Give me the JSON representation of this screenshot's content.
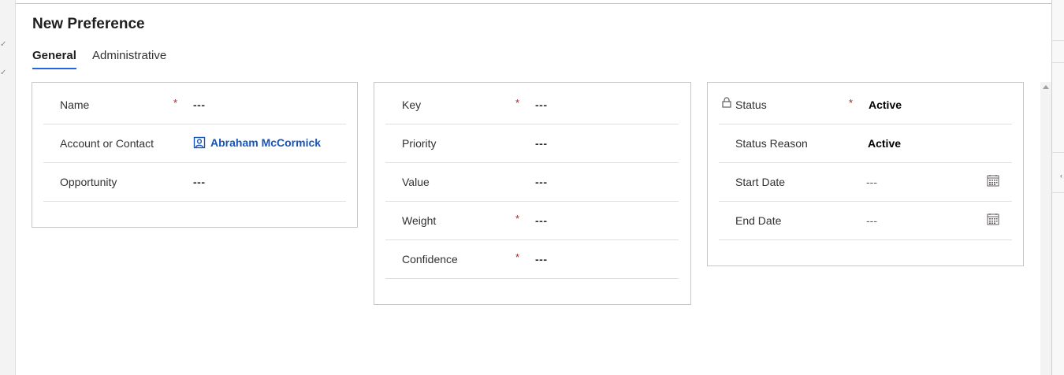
{
  "dialog": {
    "title": "New Preference"
  },
  "tabs": [
    {
      "label": "General",
      "active": true
    },
    {
      "label": "Administrative",
      "active": false
    }
  ],
  "section_left": {
    "rows": [
      {
        "label": "Name",
        "required": true,
        "value": "---"
      },
      {
        "label": "Account or Contact",
        "required": false,
        "value": "Abraham McCormick",
        "icon": "contact-icon"
      },
      {
        "label": "Opportunity",
        "required": false,
        "value": "---"
      }
    ]
  },
  "section_middle": {
    "rows": [
      {
        "label": "Key",
        "required": true,
        "value": "---"
      },
      {
        "label": "Priority",
        "required": false,
        "value": "---"
      },
      {
        "label": "Value",
        "required": false,
        "value": "---"
      },
      {
        "label": "Weight",
        "required": true,
        "value": "---"
      },
      {
        "label": "Confidence",
        "required": true,
        "value": "---"
      }
    ]
  },
  "section_right": {
    "rows": [
      {
        "label": "Status",
        "required": true,
        "value": "Active",
        "locked": true
      },
      {
        "label": "Status Reason",
        "required": false,
        "value": "Active"
      },
      {
        "label": "Start Date",
        "required": false,
        "value": "---",
        "icon": "calendar-icon"
      },
      {
        "label": "End Date",
        "required": false,
        "value": "---",
        "icon": "calendar-icon"
      }
    ]
  },
  "required_marker": "*",
  "colors": {
    "accent": "#2266e3",
    "link": "#1755b8",
    "required": "#a4262c"
  }
}
